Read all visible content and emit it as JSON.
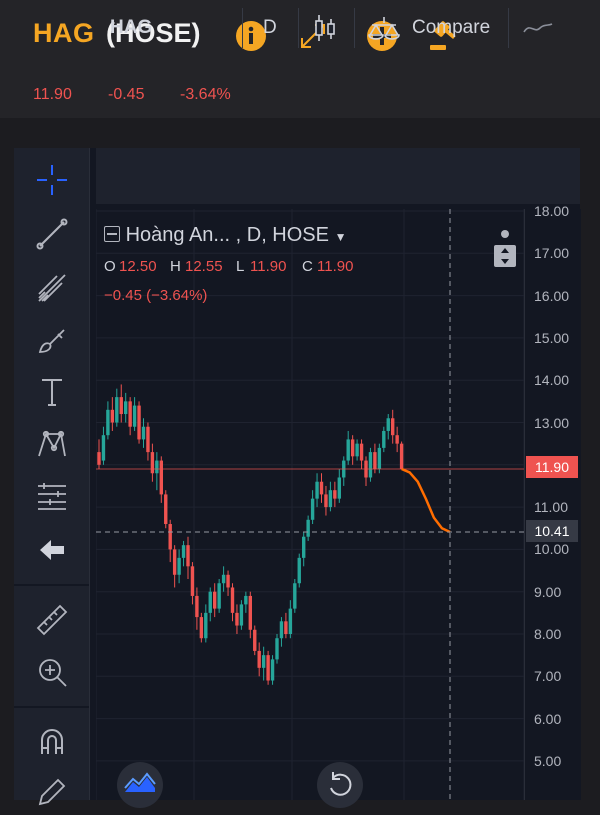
{
  "header": {
    "symbol": "HAG",
    "exchange": "(HOSE)",
    "last": "11.90",
    "change": "-0.45",
    "change_pct": "-3.64%"
  },
  "chart_toolbar": {
    "symbol": "HAG",
    "interval": "D",
    "compare_label": "Compare"
  },
  "legend": {
    "title": "Hoàng An...   , D, HOSE",
    "o_label": "O",
    "o": "12.50",
    "h_label": "H",
    "h": "12.55",
    "l_label": "L",
    "l": "11.90",
    "c_label": "C",
    "c": "11.90",
    "change": "−0.45 (−3.64%)"
  },
  "price_axis": {
    "ticks": [
      "18.00",
      "17.00",
      "16.00",
      "15.00",
      "14.00",
      "13.00",
      "12.00",
      "11.00",
      "10.00",
      "9.00",
      "8.00",
      "7.00",
      "6.00",
      "5.00"
    ],
    "last_price_tag": "11.90",
    "crosshair_tag": "10.41"
  },
  "colors": {
    "accent": "#f5a623",
    "down": "#ef5350",
    "up": "#26a69a",
    "forecast": "#ff6d00",
    "background": "#131722"
  },
  "candles": [
    [
      12.3,
      12.0,
      12.6,
      11.9
    ],
    [
      12.1,
      12.7,
      12.9,
      12.0
    ],
    [
      12.7,
      13.3,
      13.5,
      12.6
    ],
    [
      13.3,
      13.0,
      13.6,
      12.8
    ],
    [
      13.0,
      13.6,
      13.8,
      12.9
    ],
    [
      13.6,
      13.2,
      13.9,
      13.0
    ],
    [
      13.2,
      13.5,
      13.7,
      13.0
    ],
    [
      13.5,
      12.9,
      13.6,
      12.7
    ],
    [
      12.9,
      13.4,
      13.6,
      12.8
    ],
    [
      13.4,
      12.6,
      13.5,
      12.5
    ],
    [
      12.6,
      12.9,
      13.1,
      12.4
    ],
    [
      12.9,
      12.3,
      13.0,
      12.1
    ],
    [
      12.3,
      11.8,
      12.5,
      11.6
    ],
    [
      11.8,
      12.1,
      12.3,
      11.4
    ],
    [
      12.1,
      11.3,
      12.2,
      11.1
    ],
    [
      11.3,
      10.6,
      11.4,
      10.5
    ],
    [
      10.6,
      10.0,
      10.7,
      9.7
    ],
    [
      10.0,
      9.4,
      10.1,
      9.1
    ],
    [
      9.4,
      9.8,
      10.0,
      9.2
    ],
    [
      9.8,
      10.1,
      10.2,
      9.6
    ],
    [
      10.1,
      9.6,
      10.3,
      9.3
    ],
    [
      9.6,
      8.9,
      9.7,
      8.7
    ],
    [
      8.9,
      8.4,
      9.1,
      8.1
    ],
    [
      8.4,
      7.9,
      8.5,
      7.8
    ],
    [
      7.9,
      8.5,
      8.7,
      7.8
    ],
    [
      8.5,
      9.0,
      9.1,
      8.3
    ],
    [
      9.0,
      8.6,
      9.2,
      8.4
    ],
    [
      8.6,
      9.2,
      9.3,
      8.5
    ],
    [
      9.2,
      9.4,
      9.6,
      9.0
    ],
    [
      9.4,
      9.1,
      9.5,
      8.9
    ],
    [
      9.1,
      8.5,
      9.2,
      8.3
    ],
    [
      8.5,
      8.2,
      8.7,
      8.0
    ],
    [
      8.2,
      8.7,
      8.8,
      8.1
    ],
    [
      8.7,
      8.9,
      9.0,
      8.5
    ],
    [
      8.9,
      8.1,
      9.0,
      7.9
    ],
    [
      8.1,
      7.6,
      8.2,
      7.5
    ],
    [
      7.6,
      7.2,
      7.8,
      7.0
    ],
    [
      7.2,
      7.5,
      7.7,
      6.9
    ],
    [
      7.5,
      6.9,
      7.6,
      6.8
    ],
    [
      6.9,
      7.4,
      7.5,
      6.8
    ],
    [
      7.4,
      7.9,
      8.0,
      7.3
    ],
    [
      7.9,
      8.3,
      8.4,
      7.7
    ],
    [
      8.3,
      8.0,
      8.5,
      7.9
    ],
    [
      8.0,
      8.6,
      8.8,
      7.9
    ],
    [
      8.6,
      9.2,
      9.3,
      8.5
    ],
    [
      9.2,
      9.8,
      9.9,
      9.1
    ],
    [
      9.8,
      10.3,
      10.4,
      9.6
    ],
    [
      10.3,
      10.7,
      10.8,
      10.2
    ],
    [
      10.7,
      11.2,
      11.4,
      10.6
    ],
    [
      11.2,
      11.6,
      11.8,
      11.0
    ],
    [
      11.6,
      11.3,
      11.8,
      11.1
    ],
    [
      11.3,
      11.0,
      11.5,
      10.8
    ],
    [
      11.0,
      11.4,
      11.6,
      10.9
    ],
    [
      11.4,
      11.2,
      11.6,
      11.0
    ],
    [
      11.2,
      11.7,
      11.9,
      11.1
    ],
    [
      11.7,
      12.1,
      12.2,
      11.5
    ],
    [
      12.1,
      12.6,
      12.8,
      12.0
    ],
    [
      12.6,
      12.2,
      12.7,
      12.0
    ],
    [
      12.2,
      12.5,
      12.6,
      12.1
    ],
    [
      12.5,
      12.1,
      12.6,
      11.9
    ],
    [
      12.1,
      11.7,
      12.2,
      11.5
    ],
    [
      11.7,
      12.3,
      12.4,
      11.6
    ],
    [
      12.3,
      11.9,
      12.5,
      11.8
    ],
    [
      11.9,
      12.4,
      12.5,
      11.8
    ],
    [
      12.4,
      12.8,
      12.9,
      12.3
    ],
    [
      12.8,
      13.1,
      13.2,
      12.6
    ],
    [
      13.1,
      12.7,
      13.3,
      12.5
    ],
    [
      12.7,
      12.5,
      12.9,
      12.3
    ],
    [
      12.5,
      11.9,
      12.55,
      11.9
    ]
  ],
  "forecast_line": [
    11.9,
    11.82,
    11.6,
    11.2,
    10.75,
    10.5,
    10.41
  ]
}
